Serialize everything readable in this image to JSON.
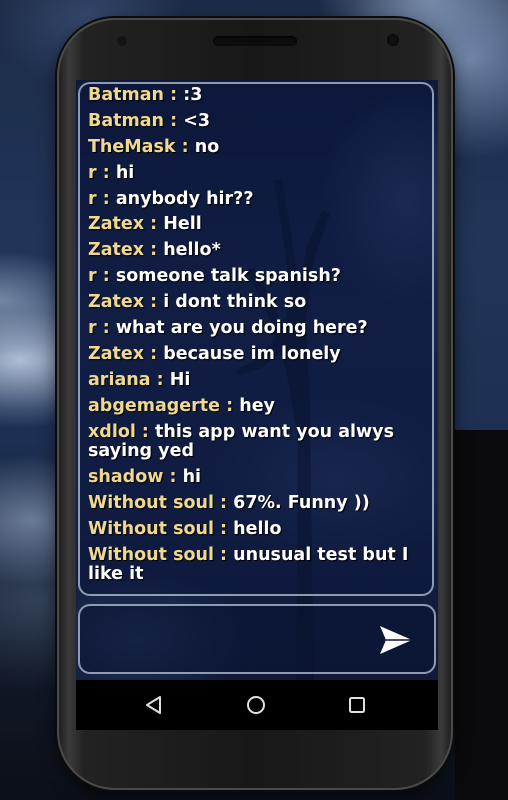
{
  "chat": {
    "messages": [
      {
        "user": "Batman",
        "text": ":3"
      },
      {
        "user": "Batman",
        "text": "<3"
      },
      {
        "user": "TheMask",
        "text": "no"
      },
      {
        "user": "r",
        "text": "hi"
      },
      {
        "user": "r",
        "text": "anybody hir??"
      },
      {
        "user": "Zatex",
        "text": "Hell"
      },
      {
        "user": "Zatex",
        "text": "hello*"
      },
      {
        "user": "r",
        "text": "someone talk spanish?"
      },
      {
        "user": "Zatex",
        "text": "i dont think so"
      },
      {
        "user": "r",
        "text": "what are you doing here?"
      },
      {
        "user": "Zatex",
        "text": "because im lonely"
      },
      {
        "user": "ariana",
        "text": "Hi"
      },
      {
        "user": "abgemagerte",
        "text": "hey"
      },
      {
        "user": "xdlol",
        "text": "this app want you alwys saying yed"
      },
      {
        "user": "shadow",
        "text": "hi"
      },
      {
        "user": "Without soul",
        "text": "67%. Funny ))"
      },
      {
        "user": "Without soul",
        "text": "hello"
      },
      {
        "user": "Without soul",
        "text": "unusual test but I like it"
      }
    ],
    "separator": " : "
  },
  "composer": {
    "value": "",
    "placeholder": "",
    "send_icon": "send-icon"
  },
  "navigation": {
    "back_icon": "back-triangle-icon",
    "home_icon": "home-circle-icon",
    "recents_icon": "recents-square-icon"
  },
  "colors": {
    "username": "#f0d890",
    "message": "#ffffff",
    "panel_border": "#c8d2e6"
  }
}
